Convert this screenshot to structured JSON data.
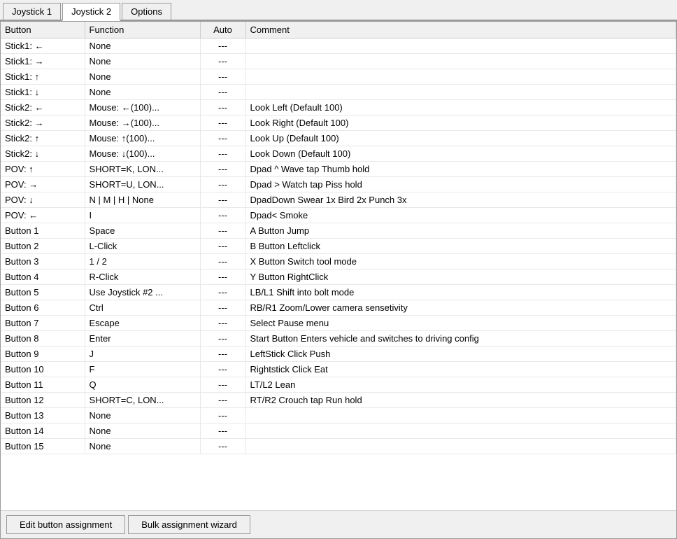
{
  "tabs": [
    {
      "label": "Joystick 1",
      "active": false
    },
    {
      "label": "Joystick 2",
      "active": true
    },
    {
      "label": "Options",
      "active": false
    }
  ],
  "table": {
    "headers": [
      "Button",
      "Function",
      "Auto",
      "Comment"
    ],
    "rows": [
      {
        "button": "Stick1: ←",
        "function": "None",
        "auto": "---",
        "comment": ""
      },
      {
        "button": "Stick1: →",
        "function": "None",
        "auto": "---",
        "comment": ""
      },
      {
        "button": "Stick1: ↑",
        "function": "None",
        "auto": "---",
        "comment": ""
      },
      {
        "button": "Stick1: ↓",
        "function": "None",
        "auto": "---",
        "comment": ""
      },
      {
        "button": "Stick2: ←",
        "function": "Mouse: ←(100)...",
        "auto": "---",
        "comment": "Look Left (Default 100)"
      },
      {
        "button": "Stick2: →",
        "function": "Mouse: →(100)...",
        "auto": "---",
        "comment": "Look Right (Default 100)"
      },
      {
        "button": "Stick2: ↑",
        "function": "Mouse: ↑(100)...",
        "auto": "---",
        "comment": "Look Up (Default 100)"
      },
      {
        "button": "Stick2: ↓",
        "function": "Mouse: ↓(100)...",
        "auto": "---",
        "comment": "Look Down (Default 100)"
      },
      {
        "button": "POV: ↑",
        "function": "SHORT=K, LON...",
        "auto": "---",
        "comment": "Dpad ^ Wave tap Thumb hold"
      },
      {
        "button": "POV: →",
        "function": "SHORT=U, LON...",
        "auto": "---",
        "comment": "Dpad > Watch tap Piss hold"
      },
      {
        "button": "POV: ↓",
        "function": "N | M | H | None",
        "auto": "---",
        "comment": "DpadDown Swear 1x Bird 2x Punch 3x"
      },
      {
        "button": "POV: ←",
        "function": "I",
        "auto": "---",
        "comment": "Dpad< Smoke"
      },
      {
        "button": "Button 1",
        "function": "Space",
        "auto": "---",
        "comment": "A Button Jump"
      },
      {
        "button": "Button 2",
        "function": "L-Click",
        "auto": "---",
        "comment": "B Button Leftclick"
      },
      {
        "button": "Button 3",
        "function": "1 / 2",
        "auto": "---",
        "comment": "X Button Switch tool mode"
      },
      {
        "button": "Button 4",
        "function": "R-Click",
        "auto": "---",
        "comment": "Y Button RightClick"
      },
      {
        "button": "Button 5",
        "function": "Use Joystick #2 ...",
        "auto": "---",
        "comment": "LB/L1 Shift into bolt mode"
      },
      {
        "button": "Button 6",
        "function": "Ctrl",
        "auto": "---",
        "comment": "RB/R1 Zoom/Lower camera sensetivity"
      },
      {
        "button": "Button 7",
        "function": "Escape",
        "auto": "---",
        "comment": "Select Pause menu"
      },
      {
        "button": "Button 8",
        "function": "Enter",
        "auto": "---",
        "comment": "Start Button Enters vehicle and switches to driving config"
      },
      {
        "button": "Button 9",
        "function": "J",
        "auto": "---",
        "comment": "LeftStick Click Push"
      },
      {
        "button": "Button 10",
        "function": "F",
        "auto": "---",
        "comment": "Rightstick Click Eat"
      },
      {
        "button": "Button 11",
        "function": "Q",
        "auto": "---",
        "comment": "LT/L2 Lean"
      },
      {
        "button": "Button 12",
        "function": "SHORT=C, LON...",
        "auto": "---",
        "comment": "RT/R2 Crouch tap Run hold"
      },
      {
        "button": "Button 13",
        "function": "None",
        "auto": "---",
        "comment": ""
      },
      {
        "button": "Button 14",
        "function": "None",
        "auto": "---",
        "comment": ""
      },
      {
        "button": "Button 15",
        "function": "None",
        "auto": "---",
        "comment": ""
      }
    ]
  },
  "footer": {
    "edit_label": "Edit button assignment",
    "bulk_label": "Bulk assignment wizard"
  }
}
